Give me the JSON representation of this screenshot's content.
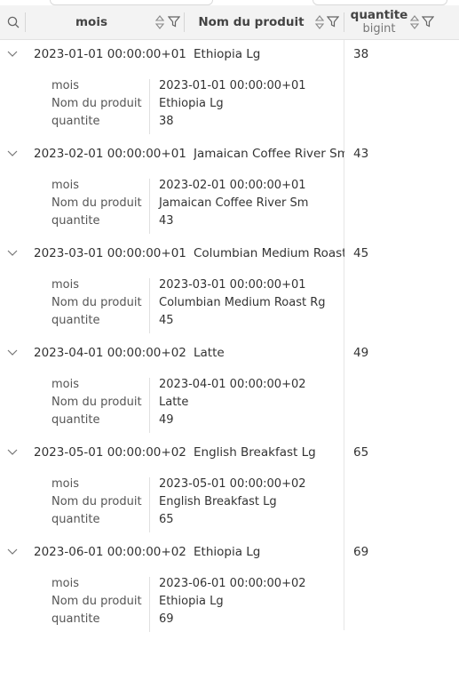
{
  "columns": {
    "mois": "mois",
    "produit": "Nom du produit",
    "quantite": "quantite",
    "quantite_type": "bigint"
  },
  "detail_labels": {
    "mois": "mois",
    "produit": "Nom du produit",
    "quantite": "quantite"
  },
  "rows": [
    {
      "mois": "2023-01-01 00:00:00+01",
      "produit": "Ethiopia Lg",
      "produit_cell": "Ethiopia Lg",
      "quantite": "38"
    },
    {
      "mois": "2023-02-01 00:00:00+01",
      "produit": "Jamaican Coffee River Sm",
      "produit_cell": "Jamaican Coffee River Sm",
      "quantite": "43"
    },
    {
      "mois": "2023-03-01 00:00:00+01",
      "produit": "Columbian Medium Roast Rg",
      "produit_cell": "Columbian Medium Roast R",
      "quantite": "45"
    },
    {
      "mois": "2023-04-01 00:00:00+02",
      "produit": "Latte",
      "produit_cell": "Latte",
      "quantite": "49"
    },
    {
      "mois": "2023-05-01 00:00:00+02",
      "produit": "English Breakfast Lg",
      "produit_cell": "English Breakfast Lg",
      "quantite": "65"
    },
    {
      "mois": "2023-06-01 00:00:00+02",
      "produit": "Ethiopia Lg",
      "produit_cell": "Ethiopia Lg",
      "quantite": "69"
    }
  ]
}
